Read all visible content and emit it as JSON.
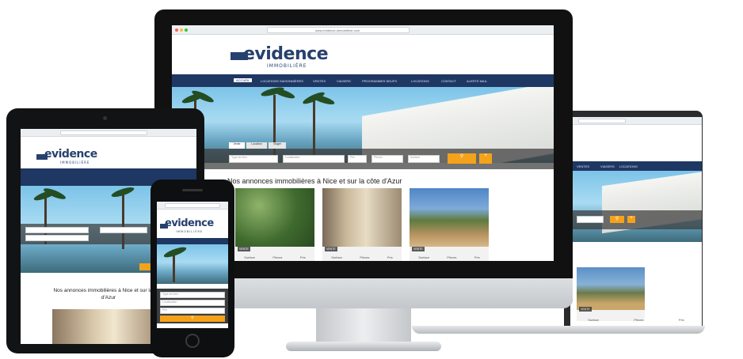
{
  "brand": {
    "logo_main": "evidence",
    "logo_sub": "IMMOBILIÈRE",
    "accent_color": "#f5a21b",
    "nav_color": "#1f3763"
  },
  "browser": {
    "url": "www.evidence-immobiliere.com"
  },
  "nav": {
    "items": [
      "ACCUEIL",
      "LOCATIONS SAISONNIÈRES",
      "VENTES",
      "VIAGERS",
      "PROGRAMMES NEUFS",
      "LOCATIONS",
      "CONTACT",
      "ALERTE MAIL"
    ]
  },
  "search": {
    "tabs": [
      "Vente",
      "Location",
      "Viager"
    ],
    "fields": [
      "Type de bien",
      "Localisation",
      "Prix",
      "Pièces",
      "Surface"
    ],
    "submit_icon": "search-icon",
    "more_icon": "plus-icon"
  },
  "listings": {
    "heading": "Nos annonces immobilières à Nice et sur la côte d'Azur",
    "heading_line1": "Nos annonces immobilières à Nice et sur la côte",
    "heading_line2": "d'Azur",
    "cards": [
      {
        "tag": "VENTE",
        "meta": [
          "Surface",
          "Pièces",
          "Prix"
        ]
      },
      {
        "tag": "VENTE",
        "meta": [
          "Surface",
          "Pièces",
          "Prix"
        ]
      },
      {
        "tag": "VENTE",
        "meta": [
          "Surface",
          "Pièces",
          "Prix"
        ]
      }
    ]
  },
  "laptop": {
    "nav_items": [
      "VENTES",
      "VIAGERS",
      "LOCATIONS"
    ]
  },
  "phone": {
    "field_labels": [
      "Type de bien",
      "Localisation",
      "Prix"
    ]
  }
}
